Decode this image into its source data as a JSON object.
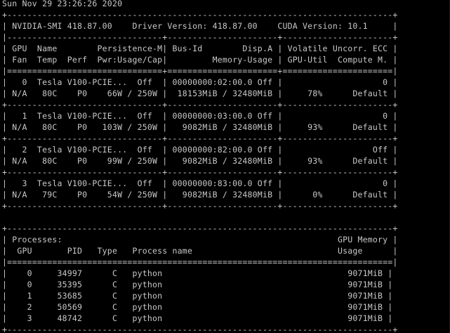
{
  "terminal": {
    "lines": [
      "Sun Nov 29 23:26:26 2020",
      "+-----------------------------------------------------------------------------+",
      "| NVIDIA-SMI 418.87.00    Driver Version: 418.87.00    CUDA Version: 10.1     |",
      "|-------------------------------+----------------------+----------------------+",
      "| GPU  Name        Persistence-M| Bus-Id        Disp.A | Volatile Uncorr. ECC |",
      "| Fan  Temp  Perf  Pwr:Usage/Cap|         Memory-Usage | GPU-Util  Compute M. |",
      "|===============================+======================+======================|",
      "|   0  Tesla V100-PCIE...  Off  | 00000000:02:00.0 Off |                    0 |",
      "| N/A   80C    P0    66W / 250W |  18153MiB / 32480MiB |     78%      Default |",
      "+-------------------------------+----------------------+----------------------+",
      "|   1  Tesla V100-PCIE...  Off  | 00000000:03:00.0 Off |                    0 |",
      "| N/A   80C    P0   103W / 250W |   9082MiB / 32480MiB |     93%      Default |",
      "+-------------------------------+----------------------+----------------------+",
      "|   2  Tesla V100-PCIE...  Off  | 00000000:82:00.0 Off |                  Off |",
      "| N/A   80C    P0    99W / 250W |   9082MiB / 32480MiB |     93%      Default |",
      "+-------------------------------+----------------------+----------------------+",
      "|   3  Tesla V100-PCIE...  Off  | 00000000:83:00.0 Off |                    0 |",
      "| N/A   79C    P0    54W / 250W |   9082MiB / 32480MiB |      0%      Default |",
      "+-------------------------------+----------------------+----------------------+",
      "",
      "+-----------------------------------------------------------------------------+",
      "| Processes:                                                       GPU Memory |",
      "|  GPU       PID   Type   Process name                             Usage      |",
      "|=============================================================================|",
      "|    0     34997      C   python                                     9071MiB |",
      "|    0     35395      C   python                                     9071MiB |",
      "|    1     53685      C   python                                     9071MiB |",
      "|    2     50569      C   python                                     9071MiB |",
      "|    3     48742      C   python                                     9071MiB |",
      "+-----------------------------------------------------------------------------+"
    ]
  },
  "colors": {
    "background": "#000000",
    "text": "#c8c8c8"
  }
}
